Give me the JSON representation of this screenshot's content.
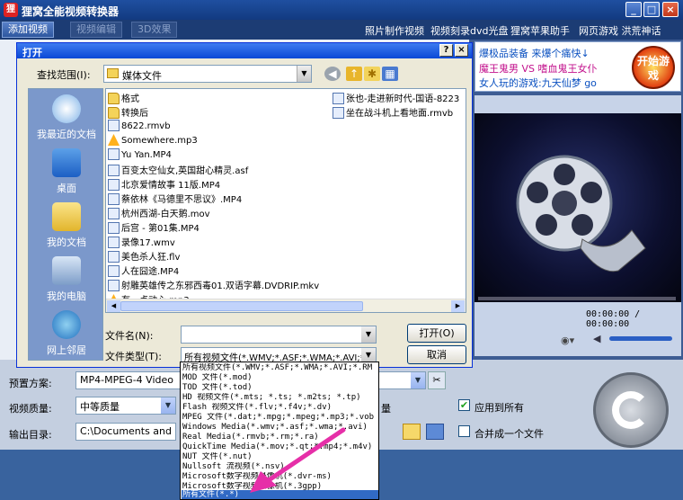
{
  "app": {
    "title": "狸窝全能视频转换器",
    "logo_char": "狸",
    "tabs": [
      "添加视频",
      "视频编辑",
      "3D效果"
    ],
    "top_links": [
      "照片制作视频",
      "视频刻录dvd光盘",
      "狸窝苹果助手",
      "网页游戏 洪荒神话"
    ],
    "window_buttons": [
      "_",
      "□",
      "×"
    ]
  },
  "ad": {
    "lines": [
      "爆极品装备 来爆个痛快↓",
      "魔王鬼男 VS 嗜血鬼王女仆",
      "女人玩的游戏:九天仙梦 go"
    ],
    "badge": "开始游戏"
  },
  "preview": {
    "time": "00:00:00 / 00:00:00"
  },
  "settings": {
    "preset_label": "预置方案:",
    "preset_value": "MP4-MPEG-4 Video",
    "quality_label": "视频质量:",
    "quality_value": "中等质量",
    "audio_partial": "量",
    "apply_all": "应用到所有",
    "output_label": "输出目录:",
    "output_value": "C:\\Documents and Set",
    "merge": "合并成一个文件"
  },
  "dialog": {
    "title": "打开",
    "help_btn": "?",
    "close_btn": "×",
    "lookin_label": "查找范围(I):",
    "lookin_value": "媒体文件",
    "places": [
      "我最近的文档",
      "桌面",
      "我的文档",
      "我的电脑",
      "网上邻居"
    ],
    "files_col1": [
      {
        "name": "格式",
        "type": "folder"
      },
      {
        "name": "转换后",
        "type": "folder"
      },
      {
        "name": "8622.rmvb",
        "type": "video"
      },
      {
        "name": "Somewhere.mp3",
        "type": "audio"
      },
      {
        "name": "Yu Yan.MP4",
        "type": "video"
      },
      {
        "name": "百变太空仙女,英国甜心精灵.asf",
        "type": "video"
      },
      {
        "name": "北京爱情故事 11版.MP4",
        "type": "video"
      },
      {
        "name": "蔡依林《马德里不思议》.MP4",
        "type": "video"
      },
      {
        "name": "杭州西湖-白天鹅.mov",
        "type": "video"
      },
      {
        "name": "后宫 - 第01集.MP4",
        "type": "video"
      },
      {
        "name": "录像17.wmv",
        "type": "video"
      },
      {
        "name": "美色杀人狂.flv",
        "type": "video"
      },
      {
        "name": "人在囧途.MP4",
        "type": "video"
      },
      {
        "name": "射雕英雄传之东邪西毒01.双语字幕.DVDRIP.mkv",
        "type": "video"
      },
      {
        "name": "有一点动心.mp3",
        "type": "audio"
      }
    ],
    "files_col2": [
      {
        "name": "张也-走进新时代-国语-8223",
        "type": "video"
      },
      {
        "name": "坐在战斗机上看地面.rmvb",
        "type": "video"
      }
    ],
    "filename_label": "文件名(N):",
    "filename_value": "",
    "filetype_label": "文件类型(T):",
    "filetype_value": "所有视频文件(*.WMV;*.ASF;*.WMA;*.AVI;*.RM",
    "open_btn": "打开(O)",
    "cancel_btn": "取消"
  },
  "dropdown": {
    "options": [
      "所有视频文件(*.WMV;*.ASF;*.WMA;*.AVI;*.RM",
      "MOD 文件(*.mod)",
      "TOD 文件(*.tod)",
      "HD 视频文件(*.mts; *.ts; *.m2ts; *.tp)",
      "Flash 视频文件(*.flv;*.f4v;*.dv)",
      "MPEG 文件(*.dat;*.mpg;*.mpeg;*.mp3;*.vob",
      "Windows Media(*.wmv;*.asf;*.wma;*.avi)",
      "Real Media(*.rmvb;*.rm;*.ra)",
      "QuickTime Media(*.mov;*.qt;*.mp4;*.m4v)",
      "NUT 文件(*.nut)",
      "Nullsoft 流视频(*.nsv)",
      "Microsoft数字视频录像机(*.dvr-ms)",
      "Microsoft数字视频录像机(*.3gpp)",
      "所有文件(*.*)"
    ],
    "selected_index": 13
  },
  "colors": {
    "accent": "#316ac5",
    "arrow": "#e62fa8"
  }
}
